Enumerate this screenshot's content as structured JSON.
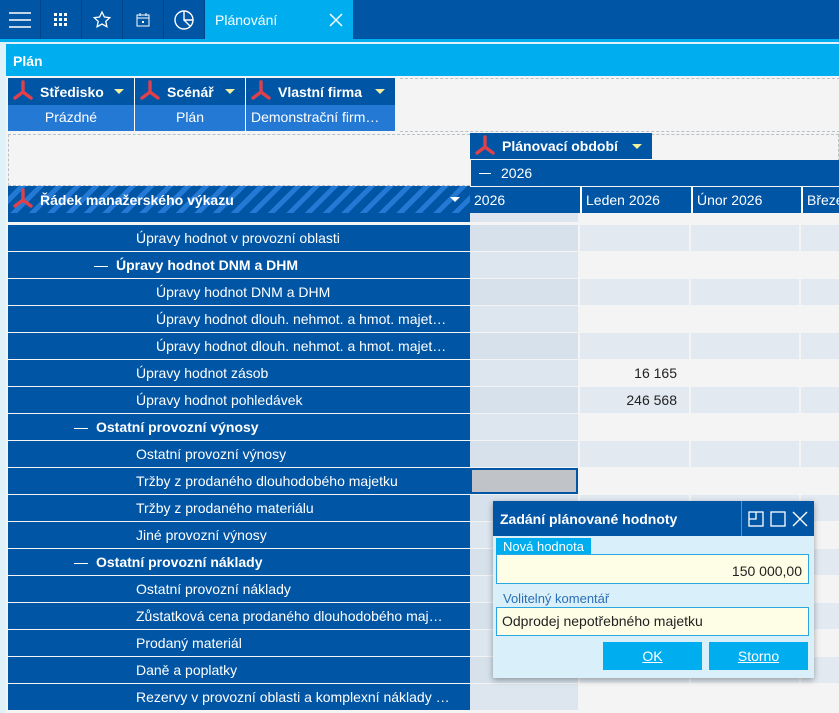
{
  "topbar": {
    "icons": [
      "menu-icon",
      "apps-grid-icon",
      "star-icon",
      "calendar-icon",
      "pie-chart-icon"
    ],
    "active_tab": "Plánování"
  },
  "panel": {
    "title": "Plán"
  },
  "filters": [
    {
      "label": "Středisko",
      "value": "Prázdné"
    },
    {
      "label": "Scénář",
      "value": "Plán"
    },
    {
      "label": "Vlastní firma",
      "value": "Demonstrační firm…"
    }
  ],
  "pivot": {
    "column_field": "Plánovací období",
    "year_group": "2026",
    "row_field": "Řádek manažerského výkazu",
    "columns": [
      "2026",
      "Leden 2026",
      "Únor 2026",
      "Březe"
    ],
    "rows": [
      {
        "label": "Úpravy hodnot v provozní oblasti",
        "level": 2,
        "bold": false,
        "values": [
          "",
          "",
          ""
        ]
      },
      {
        "label": "Úpravy hodnot DNM a DHM",
        "level": 1,
        "bold": true,
        "values": [
          "",
          "",
          ""
        ]
      },
      {
        "label": "Úpravy hodnot DNM a DHM",
        "level": 3,
        "bold": false,
        "values": [
          "",
          "",
          ""
        ]
      },
      {
        "label": "Úpravy hodnot dlouh. nehmot. a hmot. majet…",
        "level": 3,
        "bold": false,
        "values": [
          "",
          "",
          ""
        ]
      },
      {
        "label": "Úpravy hodnot dlouh. nehmot. a hmot. majet…",
        "level": 3,
        "bold": false,
        "values": [
          "",
          "",
          ""
        ]
      },
      {
        "label": "Úpravy hodnot zásob",
        "level": 2,
        "bold": false,
        "values": [
          "",
          "16 165",
          ""
        ]
      },
      {
        "label": "Úpravy hodnot pohledávek",
        "level": 2,
        "bold": false,
        "values": [
          "",
          "246 568",
          ""
        ]
      },
      {
        "label": "Ostatní provozní výnosy",
        "level": 0,
        "bold": true,
        "values": [
          "",
          "",
          ""
        ]
      },
      {
        "label": "Ostatní provozní výnosy",
        "level": 2,
        "bold": false,
        "values": [
          "",
          "",
          ""
        ]
      },
      {
        "label": "Tržby z prodaného dlouhodobého majetku",
        "level": 2,
        "bold": false,
        "values": [
          "",
          "",
          ""
        ],
        "selected": true
      },
      {
        "label": "Tržby z prodaného materiálu",
        "level": 2,
        "bold": false,
        "values": [
          "",
          "",
          ""
        ]
      },
      {
        "label": "Jiné provozní výnosy",
        "level": 2,
        "bold": false,
        "values": [
          "",
          "",
          ""
        ]
      },
      {
        "label": "Ostatní provozní náklady",
        "level": 0,
        "bold": true,
        "values": [
          "",
          "",
          ""
        ]
      },
      {
        "label": "Ostatní provozní náklady",
        "level": 2,
        "bold": false,
        "values": [
          "",
          "",
          ""
        ]
      },
      {
        "label": "Zůstatková cena prodaného dlouhodobého maj…",
        "level": 2,
        "bold": false,
        "values": [
          "",
          "",
          ""
        ]
      },
      {
        "label": "Prodaný materiál",
        "level": 2,
        "bold": false,
        "values": [
          "",
          "",
          ""
        ]
      },
      {
        "label": "Daně a poplatky",
        "level": 2,
        "bold": false,
        "values": [
          "",
          "",
          ""
        ]
      },
      {
        "label": "Rezervy v provozní oblasti a komplexní náklady …",
        "level": 2,
        "bold": false,
        "values": [
          "",
          "",
          ""
        ]
      }
    ]
  },
  "dialog": {
    "title": "Zadání plánované hodnoty",
    "value_label": "Nová hodnota",
    "value": "150 000,00",
    "comment_label": "Volitelný komentář",
    "comment": "Odprodej nepotřebného majetku",
    "ok": "OK",
    "cancel": "Storno"
  }
}
